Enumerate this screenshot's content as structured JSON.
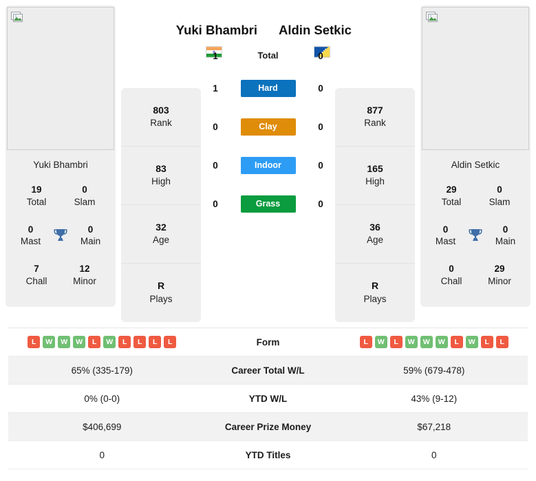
{
  "colors": {
    "hard": "#0b72bd",
    "clay": "#df8c09",
    "indoor": "#2d9cf5",
    "grass": "#0a9c3f",
    "win": "#70bf73",
    "loss": "#ef5a41",
    "trophy": "#3f6fa8",
    "panel": "#efefef",
    "row_alt": "#f2f2f2"
  },
  "players": {
    "left": {
      "name": "Yuki Bhambri",
      "photo_caption": "Yuki Bhambri",
      "flag_name": "india-flag",
      "photo_placeholder_icon": "broken-image-icon",
      "titles": [
        {
          "value": "19",
          "label": "Total"
        },
        {
          "value": "0",
          "label": "Slam"
        },
        {
          "value": "0",
          "label": "Mast"
        },
        {
          "value": "0",
          "label": "Main"
        },
        {
          "value": "7",
          "label": "Chall"
        },
        {
          "value": "12",
          "label": "Minor"
        }
      ],
      "attributes": [
        {
          "value": "803",
          "label": "Rank"
        },
        {
          "value": "83",
          "label": "High"
        },
        {
          "value": "32",
          "label": "Age"
        },
        {
          "value": "R",
          "label": "Plays"
        }
      ]
    },
    "right": {
      "name": "Aldin Setkic",
      "photo_caption": "Aldin Setkic",
      "flag_name": "bosnia-and-herzegovina-flag",
      "photo_placeholder_icon": "broken-image-icon",
      "titles": [
        {
          "value": "29",
          "label": "Total"
        },
        {
          "value": "0",
          "label": "Slam"
        },
        {
          "value": "0",
          "label": "Mast"
        },
        {
          "value": "0",
          "label": "Main"
        },
        {
          "value": "0",
          "label": "Chall"
        },
        {
          "value": "29",
          "label": "Minor"
        }
      ],
      "attributes": [
        {
          "value": "877",
          "label": "Rank"
        },
        {
          "value": "165",
          "label": "High"
        },
        {
          "value": "36",
          "label": "Age"
        },
        {
          "value": "R",
          "label": "Plays"
        }
      ]
    }
  },
  "h2h": [
    {
      "label": "Total",
      "left": "1",
      "right": "0",
      "style": "plain",
      "color": ""
    },
    {
      "label": "Hard",
      "left": "1",
      "right": "0",
      "style": "badge",
      "color": "#0b72bd"
    },
    {
      "label": "Clay",
      "left": "0",
      "right": "0",
      "style": "badge",
      "color": "#df8c09"
    },
    {
      "label": "Indoor",
      "left": "0",
      "right": "0",
      "style": "badge",
      "color": "#2d9cf5"
    },
    {
      "label": "Grass",
      "left": "0",
      "right": "0",
      "style": "badge",
      "color": "#0a9c3f"
    }
  ],
  "table": {
    "form": {
      "label": "Form",
      "left": [
        "L",
        "W",
        "W",
        "W",
        "L",
        "W",
        "L",
        "L",
        "L",
        "L"
      ],
      "right": [
        "L",
        "W",
        "L",
        "W",
        "W",
        "W",
        "L",
        "W",
        "L",
        "L"
      ]
    },
    "rows": [
      {
        "label": "Career Total W/L",
        "left": "65% (335-179)",
        "right": "59% (679-478)"
      },
      {
        "label": "YTD W/L",
        "left": "0% (0-0)",
        "right": "43% (9-12)"
      },
      {
        "label": "Career Prize Money",
        "left": "$406,699",
        "right": "$67,218"
      },
      {
        "label": "YTD Titles",
        "left": "0",
        "right": "0"
      }
    ]
  }
}
